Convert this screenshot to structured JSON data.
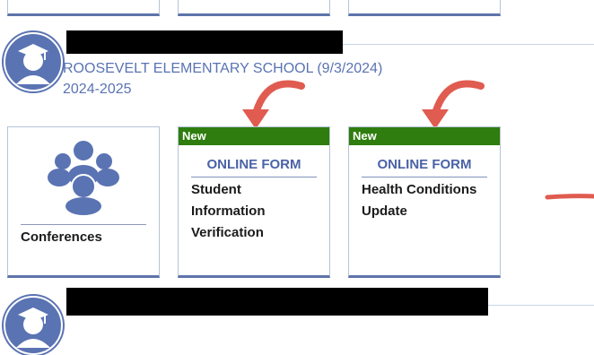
{
  "student": {
    "school": "ROOSEVELT ELEMENTARY SCHOOL (9/3/2024)",
    "year": "2024-2025"
  },
  "tiles": {
    "conferences_label": "Conferences",
    "form1": {
      "badge": "New",
      "category": "ONLINE FORM",
      "lines": [
        "Student",
        "Information",
        "Verification"
      ]
    },
    "form2": {
      "badge": "New",
      "category": "ONLINE FORM",
      "lines": [
        "Health Conditions",
        "Update"
      ]
    }
  },
  "colors": {
    "accent": "#5a73b3",
    "new_badge": "#2e7d0e",
    "annotation": "#e05b50"
  },
  "icons": {
    "avatar": "graduate-cap-icon",
    "conferences": "people-group-icon"
  }
}
